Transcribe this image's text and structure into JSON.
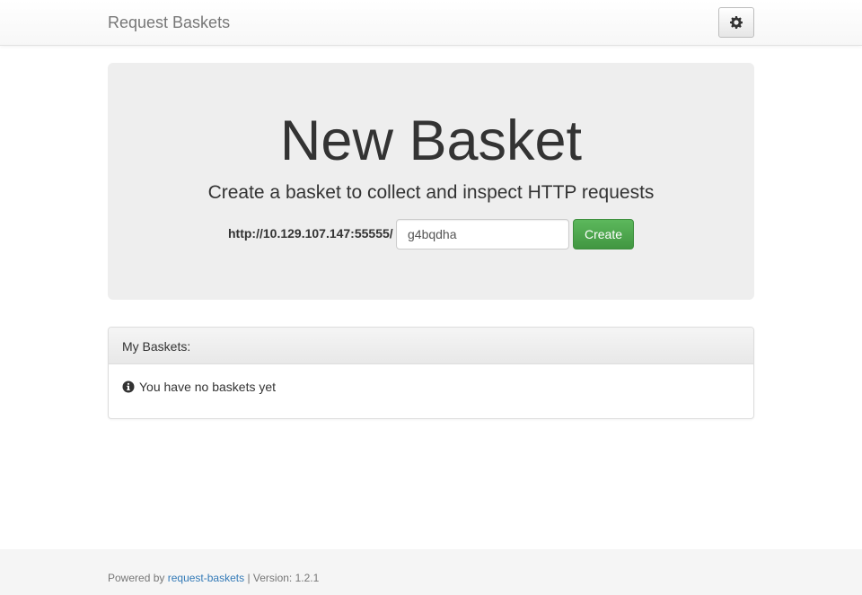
{
  "navbar": {
    "brand": "Request Baskets",
    "settings_icon": "gear-icon"
  },
  "jumbotron": {
    "title": "New Basket",
    "subtitle": "Create a basket to collect and inspect HTTP requests",
    "url_prefix": "http://10.129.107.147:55555/",
    "basket_name_value": "g4bqdha",
    "create_label": "Create"
  },
  "baskets_panel": {
    "heading": "My Baskets:",
    "empty_icon": "info-circle-icon",
    "empty_text": "You have no baskets yet"
  },
  "footer": {
    "powered_by": "Powered by",
    "link_text": "request-baskets",
    "version_text": "| Version: 1.2.1"
  },
  "colors": {
    "primary_button": "#5cb85c",
    "link": "#337ab7",
    "jumbotron_bg": "#eeeeee",
    "footer_bg": "#f5f5f5"
  }
}
